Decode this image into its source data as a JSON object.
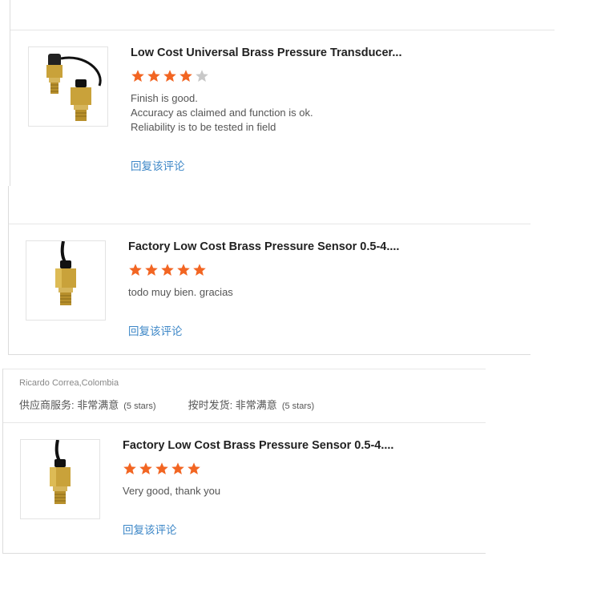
{
  "reviews": [
    {
      "title": "Low Cost Universal Brass Pressure Transducer...",
      "rating": 4,
      "max_rating": 5,
      "review_lines": [
        "Finish is good.",
        "Accuracy as claimed and function is ok.",
        "Reliability is to be tested in field"
      ],
      "reply_label": "回复该评论",
      "image_icon": "brass-transducer-with-cable-icon"
    },
    {
      "title": "Factory Low Cost Brass Pressure Sensor 0.5-4....",
      "rating": 5,
      "max_rating": 5,
      "review_lines": [
        "todo muy bien. gracias"
      ],
      "reply_label": "回复该评论",
      "image_icon": "brass-pressure-sensor-icon"
    },
    {
      "reviewer": "Ricardo Correa,Colombia",
      "ratings": [
        {
          "label": "供应商服务: 非常满意",
          "stars_note": "(5 stars)"
        },
        {
          "label": "按时发货: 非常满意",
          "stars_note": "(5 stars)"
        }
      ],
      "title": "Factory Low Cost Brass Pressure Sensor 0.5-4....",
      "rating": 5,
      "max_rating": 5,
      "review_lines": [
        "Very good, thank you"
      ],
      "reply_label": "回复该评论",
      "image_icon": "brass-pressure-sensor-icon"
    }
  ],
  "colors": {
    "star_filled": "#f26522",
    "star_empty": "#c8c8c8",
    "link": "#3d87c7"
  }
}
